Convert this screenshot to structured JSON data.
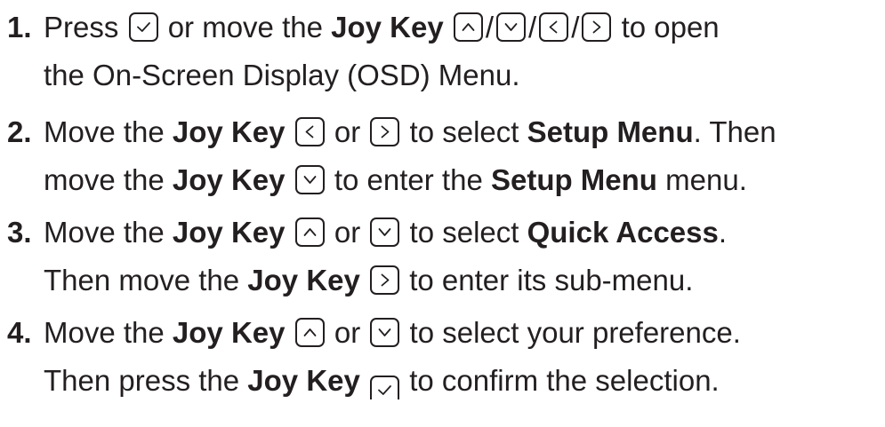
{
  "steps": [
    {
      "number": "1.",
      "line1": {
        "t1": "Press",
        "t2": "or move the",
        "b1": "Joy Key",
        "slash": "/",
        "t3": "to open"
      },
      "line2": "the On-Screen Display (OSD) Menu."
    },
    {
      "number": "2.",
      "line1": {
        "t1": "Move the",
        "b1": "Joy Key",
        "t2": "or",
        "t3": "to select",
        "b2": "Setup Menu",
        "t4": ". Then"
      },
      "line2": {
        "t1": "move the",
        "b1": "Joy Key",
        "t2": "to enter the",
        "b2": "Setup Menu",
        "t3": "menu."
      }
    },
    {
      "number": "3.",
      "line1": {
        "t1": "Move the",
        "b1": "Joy Key",
        "t2": "or",
        "t3": "to select",
        "b2": "Quick Access",
        "t4": "."
      },
      "line2": {
        "t1": "Then move the",
        "b1": "Joy Key",
        "t2": "to enter its sub-menu."
      }
    },
    {
      "number": "4.",
      "line1": {
        "t1": "Move the",
        "b1": "Joy Key",
        "t2": "or",
        "t3": "to select your preference."
      },
      "line2": {
        "t1": "Then press the",
        "b1": "Joy Key",
        "t2": "to confirm the selection."
      }
    }
  ],
  "icons": {
    "check": "check-icon",
    "up": "chevron-up-icon",
    "down": "chevron-down-icon",
    "left": "chevron-left-icon",
    "right": "chevron-right-icon"
  },
  "colors": {
    "text": "#231f20",
    "background": "#ffffff"
  }
}
